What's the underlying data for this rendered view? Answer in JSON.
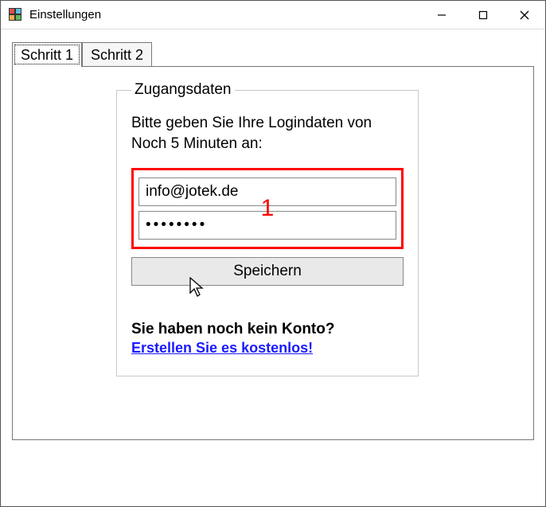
{
  "window": {
    "title": "Einstellungen"
  },
  "tabs": [
    {
      "label": "Schritt 1",
      "active": true
    },
    {
      "label": "Schritt 2",
      "active": false
    }
  ],
  "group": {
    "legend": "Zugangsdaten",
    "hint": "Bitte geben Sie Ihre Logindaten von Noch 5 Minuten an:",
    "email_value": "info@jotek.de",
    "password_value": "••••••••",
    "save_label": "Speichern",
    "no_account_text": "Sie haben noch kein Konto?",
    "create_link_text": "Erstellen Sie es kostenlos!"
  },
  "annotation": {
    "number": "1",
    "color": "#ff0000"
  }
}
